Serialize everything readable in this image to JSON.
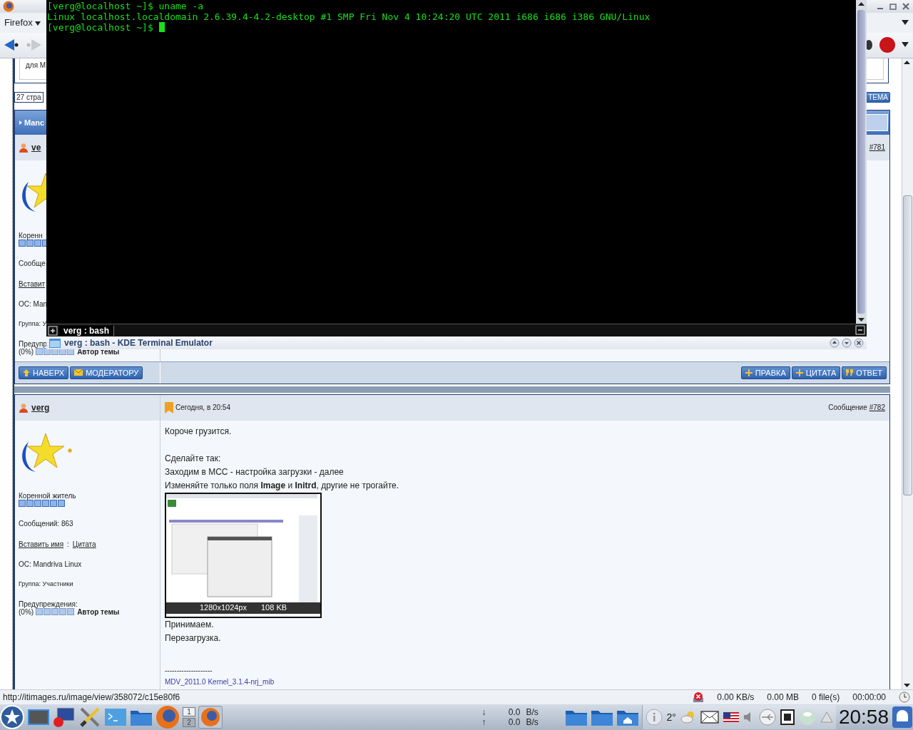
{
  "firefox": {
    "menu_button": "Firefox"
  },
  "page": {
    "top_box_text": "для М",
    "pages_label": "27 стра",
    "new_topic_button": "ТЕМА"
  },
  "post_1": {
    "header": "Manc",
    "user": "ve",
    "post_number": "#781",
    "rank": "Коренн",
    "posts_count": "Сообще",
    "insert_name": "Вставит",
    "os": "ОС: Man",
    "group": "Группа: У",
    "warnings": "Предупр",
    "warn_percent": "(0%)",
    "author_badge": "Автор темы"
  },
  "post_buttons": {
    "left": [
      {
        "kind": "up",
        "label": "НАВЕРХ"
      },
      {
        "kind": "mail",
        "label": "МОДЕРАТОРУ"
      }
    ],
    "right": [
      {
        "kind": "plus",
        "label": "ПРАВКА"
      },
      {
        "kind": "plus",
        "label": "ЦИТАТА"
      },
      {
        "kind": "quote",
        "label": "ОТВЕТ"
      }
    ]
  },
  "post_2": {
    "user": "verg",
    "date": "Сегодня, в 20:54",
    "post_label": "Сообщение",
    "post_number": "#782",
    "rank": "Коренной житель",
    "posts_count": "Сообщений: 863",
    "insert_name": "Вставить имя",
    "separator": ":",
    "quote_link": "Цитата",
    "os": "ОС: Mandriva Linux",
    "group": "Группа: Участники",
    "warnings": "Предупреждения:",
    "warn_percent": "(0%)",
    "author_badge": "Автор темы",
    "body_blocks": [
      [
        "Короче грузится."
      ],
      [
        "Сделайте так:",
        "Заходим в МСС - настройка загрузки - далее",
        "Изменяйте только поля **Image** и **Initrd**, другие не трогайте."
      ]
    ],
    "image": {
      "size": "1280x1024px",
      "weight": "108 KB"
    },
    "after": [
      "Принимаем.",
      "Перезагрузка."
    ],
    "signature_rule": "--------------------",
    "signature": "MDV_2011.0 Kernel_3.1.4-nrj_mib"
  },
  "terminal": {
    "lines": [
      "[verg@localhost ~]$ uname -a",
      "Linux localhost.localdomain 2.6.39.4-4.2-desktop #1 SMP Fri Nov 4 10:24:20 UTC 2011 i686 i686 i386 GNU/Linux",
      "[verg@localhost ~]$ "
    ],
    "tabs": [
      {
        "label": "verg : bash",
        "selected": true
      }
    ],
    "title": "verg : bash - KDE Terminal Emulator"
  },
  "status_bar": {
    "url": "http://itimages.ru/image/view/358072/c15e80f6",
    "speed": "0.00 KB/s",
    "size": "0.00 MB",
    "files": "0 file(s)",
    "time": "00:00:00"
  },
  "taskbar": {
    "pager": [
      {
        "label": "1",
        "selected": true
      },
      {
        "label": "2",
        "selected": false
      }
    ],
    "net": {
      "down_arrow": "↓",
      "down_value": "0.0",
      "down_unit": "B/s",
      "up_arrow": "↑",
      "up_value": "0.0",
      "up_unit": "B/s"
    },
    "weather": "2°",
    "clock": "20:58"
  }
}
